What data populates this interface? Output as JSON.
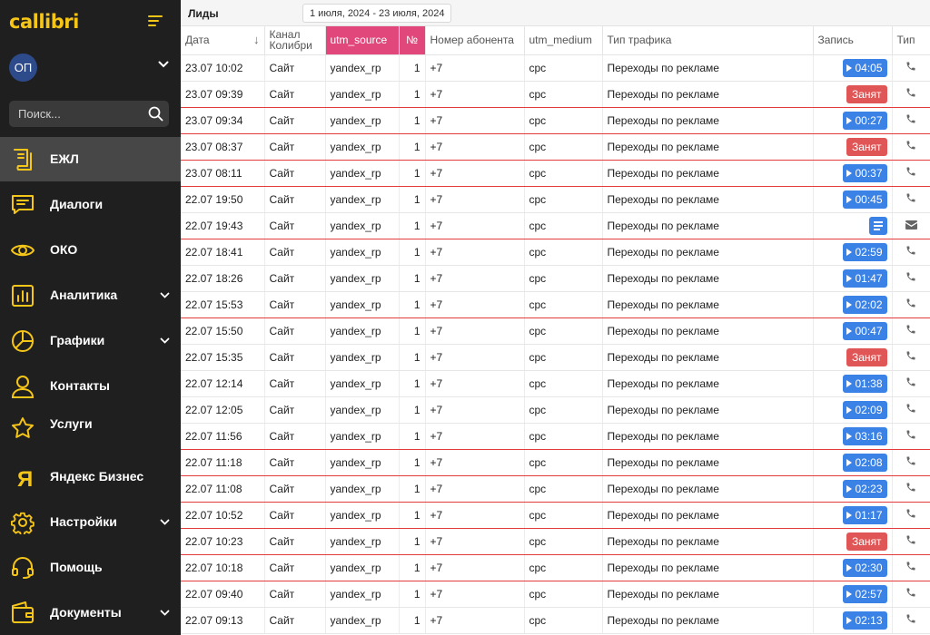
{
  "colors": {
    "sidebar_bg": "#1f1f1f",
    "accent_yellow": "#f5c518",
    "highlight_header": "#e2477c",
    "play_blue": "#3b82e6",
    "busy_red": "#e05555",
    "row_separator_red": "#e53a3a"
  },
  "sidebar": {
    "logo": "callibri",
    "account": {
      "initials": "ОП"
    },
    "search": {
      "placeholder": "Поиск..."
    },
    "items": [
      {
        "label": "ЕЖЛ",
        "icon": "journal-icon",
        "active": true,
        "expandable": false
      },
      {
        "label": "Диалоги",
        "icon": "chat-icon",
        "active": false,
        "expandable": false
      },
      {
        "label": "ОКО",
        "icon": "eye-icon",
        "active": false,
        "expandable": false
      },
      {
        "label": "Аналитика",
        "icon": "bar-chart-icon",
        "active": false,
        "expandable": true
      },
      {
        "label": "Графики",
        "icon": "pie-chart-icon",
        "active": false,
        "expandable": true
      },
      {
        "label": "Контакты",
        "icon": "user-icon",
        "active": false,
        "expandable": false
      },
      {
        "label": "Услуги",
        "icon": "star-icon",
        "active": false,
        "expandable": false
      },
      {
        "label": "Яндекс Бизнес",
        "icon": "yandex-icon",
        "active": false,
        "expandable": false
      },
      {
        "label": "Настройки",
        "icon": "gear-icon",
        "active": false,
        "expandable": true
      },
      {
        "label": "Помощь",
        "icon": "headset-icon",
        "active": false,
        "expandable": false
      },
      {
        "label": "Документы",
        "icon": "wallet-icon",
        "active": false,
        "expandable": true
      }
    ]
  },
  "header": {
    "title": "Лиды",
    "date_range": "1 июля, 2024 - 23 июля, 2024"
  },
  "table": {
    "columns": [
      {
        "key": "date",
        "label": "Дата",
        "sortable": true,
        "sort_indicator": "↓",
        "highlighted": false
      },
      {
        "key": "channel",
        "label": "Канал Колибри",
        "highlighted": false
      },
      {
        "key": "utm_source",
        "label": "utm_source",
        "highlighted": true
      },
      {
        "key": "num",
        "label": "№",
        "highlighted": true
      },
      {
        "key": "phone",
        "label": "Номер абонента",
        "highlighted": false
      },
      {
        "key": "utm_medium",
        "label": "utm_medium",
        "highlighted": false
      },
      {
        "key": "traffic",
        "label": "Тип трафика",
        "highlighted": false
      },
      {
        "key": "record",
        "label": "Запись",
        "highlighted": false
      },
      {
        "key": "type",
        "label": "Тип",
        "highlighted": false
      }
    ],
    "rows": [
      {
        "date": "23.07 10:02",
        "channel": "Сайт",
        "utm_source": "yandex_rp",
        "num": "1",
        "phone": "+7",
        "utm_medium": "cpc",
        "traffic": "Переходы по рекламе",
        "record": {
          "kind": "play",
          "text": "04:05"
        },
        "type": "phone-icon",
        "red_separator": false
      },
      {
        "date": "23.07 09:39",
        "channel": "Сайт",
        "utm_source": "yandex_rp",
        "num": "1",
        "phone": "+7",
        "utm_medium": "cpc",
        "traffic": "Переходы по рекламе",
        "record": {
          "kind": "busy",
          "text": "Занят"
        },
        "type": "phone-icon",
        "red_separator": true
      },
      {
        "date": "23.07 09:34",
        "channel": "Сайт",
        "utm_source": "yandex_rp",
        "num": "1",
        "phone": "+7",
        "utm_medium": "cpc",
        "traffic": "Переходы по рекламе",
        "record": {
          "kind": "play",
          "text": "00:27"
        },
        "type": "phone-icon",
        "red_separator": true
      },
      {
        "date": "23.07 08:37",
        "channel": "Сайт",
        "utm_source": "yandex_rp",
        "num": "1",
        "phone": "+7",
        "utm_medium": "cpc",
        "traffic": "Переходы по рекламе",
        "record": {
          "kind": "busy",
          "text": "Занят"
        },
        "type": "phone-icon",
        "red_separator": true
      },
      {
        "date": "23.07 08:11",
        "channel": "Сайт",
        "utm_source": "yandex_rp",
        "num": "1",
        "phone": "+7",
        "utm_medium": "cpc",
        "traffic": "Переходы по рекламе",
        "record": {
          "kind": "play",
          "text": "00:37"
        },
        "type": "phone-icon",
        "red_separator": true
      },
      {
        "date": "22.07 19:50",
        "channel": "Сайт",
        "utm_source": "yandex_rp",
        "num": "1",
        "phone": "+7",
        "utm_medium": "cpc",
        "traffic": "Переходы по рекламе",
        "record": {
          "kind": "play",
          "text": "00:45"
        },
        "type": "phone-icon",
        "red_separator": false
      },
      {
        "date": "22.07 19:43",
        "channel": "Сайт",
        "utm_source": "yandex_rp",
        "num": "1",
        "phone": "+7",
        "utm_medium": "cpc",
        "traffic": "Переходы по рекламе",
        "record": {
          "kind": "doc",
          "text": ""
        },
        "type": "mail-icon",
        "red_separator": true
      },
      {
        "date": "22.07 18:41",
        "channel": "Сайт",
        "utm_source": "yandex_rp",
        "num": "1",
        "phone": "+7",
        "utm_medium": "cpc",
        "traffic": "Переходы по рекламе",
        "record": {
          "kind": "play",
          "text": "02:59"
        },
        "type": "phone-icon",
        "red_separator": false
      },
      {
        "date": "22.07 18:26",
        "channel": "Сайт",
        "utm_source": "yandex_rp",
        "num": "1",
        "phone": "+7",
        "utm_medium": "cpc",
        "traffic": "Переходы по рекламе",
        "record": {
          "kind": "play",
          "text": "01:47"
        },
        "type": "phone-icon",
        "red_separator": false
      },
      {
        "date": "22.07 15:53",
        "channel": "Сайт",
        "utm_source": "yandex_rp",
        "num": "1",
        "phone": "+7",
        "utm_medium": "cpc",
        "traffic": "Переходы по рекламе",
        "record": {
          "kind": "play",
          "text": "02:02"
        },
        "type": "phone-icon",
        "red_separator": true
      },
      {
        "date": "22.07 15:50",
        "channel": "Сайт",
        "utm_source": "yandex_rp",
        "num": "1",
        "phone": "+7",
        "utm_medium": "cpc",
        "traffic": "Переходы по рекламе",
        "record": {
          "kind": "play",
          "text": "00:47"
        },
        "type": "phone-icon",
        "red_separator": false
      },
      {
        "date": "22.07 15:35",
        "channel": "Сайт",
        "utm_source": "yandex_rp",
        "num": "1",
        "phone": "+7",
        "utm_medium": "cpc",
        "traffic": "Переходы по рекламе",
        "record": {
          "kind": "busy",
          "text": "Занят"
        },
        "type": "phone-icon",
        "red_separator": false
      },
      {
        "date": "22.07 12:14",
        "channel": "Сайт",
        "utm_source": "yandex_rp",
        "num": "1",
        "phone": "+7",
        "utm_medium": "cpc",
        "traffic": "Переходы по рекламе",
        "record": {
          "kind": "play",
          "text": "01:38"
        },
        "type": "phone-icon",
        "red_separator": false
      },
      {
        "date": "22.07 12:05",
        "channel": "Сайт",
        "utm_source": "yandex_rp",
        "num": "1",
        "phone": "+7",
        "utm_medium": "cpc",
        "traffic": "Переходы по рекламе",
        "record": {
          "kind": "play",
          "text": "02:09"
        },
        "type": "phone-icon",
        "red_separator": false
      },
      {
        "date": "22.07 11:56",
        "channel": "Сайт",
        "utm_source": "yandex_rp",
        "num": "1",
        "phone": "+7",
        "utm_medium": "cpc",
        "traffic": "Переходы по рекламе",
        "record": {
          "kind": "play",
          "text": "03:16"
        },
        "type": "phone-icon",
        "red_separator": true
      },
      {
        "date": "22.07 11:18",
        "channel": "Сайт",
        "utm_source": "yandex_rp",
        "num": "1",
        "phone": "+7",
        "utm_medium": "cpc",
        "traffic": "Переходы по рекламе",
        "record": {
          "kind": "play",
          "text": "02:08"
        },
        "type": "phone-icon",
        "red_separator": true
      },
      {
        "date": "22.07 11:08",
        "channel": "Сайт",
        "utm_source": "yandex_rp",
        "num": "1",
        "phone": "+7",
        "utm_medium": "cpc",
        "traffic": "Переходы по рекламе",
        "record": {
          "kind": "play",
          "text": "02:23"
        },
        "type": "phone-icon",
        "red_separator": true
      },
      {
        "date": "22.07 10:52",
        "channel": "Сайт",
        "utm_source": "yandex_rp",
        "num": "1",
        "phone": "+7",
        "utm_medium": "cpc",
        "traffic": "Переходы по рекламе",
        "record": {
          "kind": "play",
          "text": "01:17"
        },
        "type": "phone-icon",
        "red_separator": true
      },
      {
        "date": "22.07 10:23",
        "channel": "Сайт",
        "utm_source": "yandex_rp",
        "num": "1",
        "phone": "+7",
        "utm_medium": "cpc",
        "traffic": "Переходы по рекламе",
        "record": {
          "kind": "busy",
          "text": "Занят"
        },
        "type": "phone-icon",
        "red_separator": true
      },
      {
        "date": "22.07 10:18",
        "channel": "Сайт",
        "utm_source": "yandex_rp",
        "num": "1",
        "phone": "+7",
        "utm_medium": "cpc",
        "traffic": "Переходы по рекламе",
        "record": {
          "kind": "play",
          "text": "02:30"
        },
        "type": "phone-icon",
        "red_separator": true
      },
      {
        "date": "22.07 09:40",
        "channel": "Сайт",
        "utm_source": "yandex_rp",
        "num": "1",
        "phone": "+7",
        "utm_medium": "cpc",
        "traffic": "Переходы по рекламе",
        "record": {
          "kind": "play",
          "text": "02:57"
        },
        "type": "phone-icon",
        "red_separator": false
      },
      {
        "date": "22.07 09:13",
        "channel": "Сайт",
        "utm_source": "yandex_rp",
        "num": "1",
        "phone": "+7",
        "utm_medium": "cpc",
        "traffic": "Переходы по рекламе",
        "record": {
          "kind": "play",
          "text": "02:13"
        },
        "type": "phone-icon",
        "red_separator": false
      }
    ]
  }
}
